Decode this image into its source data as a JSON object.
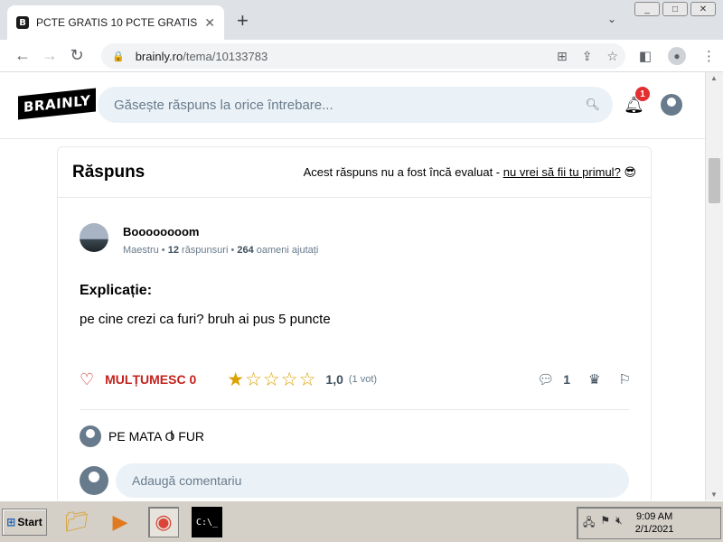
{
  "browser": {
    "tab_title": "PCTE GRATIS 10 PCTE GRATIS - B",
    "tab_close": "✕",
    "new_tab": "+",
    "url_host": "brainly.ro",
    "url_path": "/tema/10133783",
    "window_buttons": [
      "_",
      "□",
      "✕"
    ]
  },
  "header": {
    "logo": "BRAINLY",
    "search_placeholder": "Găsește răspuns la orice întrebare...",
    "notification_count": "1"
  },
  "answer_card": {
    "title": "Răspuns",
    "note_prefix": "Acest răspuns nu a fost încă evaluat - ",
    "note_link": "nu vrei să fii tu primul?",
    "note_emoji": "😎",
    "author": {
      "name": "Boooooooom",
      "rank": "Maestru",
      "answers_count": "12",
      "answers_label": "răspunsuri",
      "helped_count": "264",
      "helped_label": "oameni ajutați"
    },
    "explanation_label": "Explicație:",
    "answer_text": "pe cine crezi ca furi? bruh ai pus 5 puncte",
    "thanks_label": "MULȚUMESC 0",
    "rating_value": "1,0",
    "rating_stars": 1,
    "rating_votes": "(1 vot)",
    "comments_count": "1",
    "comment_text": "PE MATA O FUR",
    "add_comment_placeholder": "Adaugă comentariu"
  },
  "taskbar": {
    "start_label": "Start",
    "time": "9:09 AM",
    "date": "2/1/2021"
  }
}
